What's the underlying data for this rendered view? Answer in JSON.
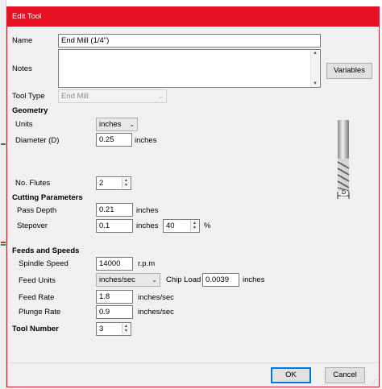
{
  "window": {
    "title": "Edit Tool"
  },
  "fields": {
    "name_label": "Name",
    "name_value": "End Mill (1/4\")",
    "notes_label": "Notes",
    "notes_value": "",
    "variables_button": "Variables",
    "tool_type_label": "Tool Type",
    "tool_type_value": "End Mill"
  },
  "geometry": {
    "heading": "Geometry",
    "units_label": "Units",
    "units_value": "inches",
    "diameter_label": "Diameter (D)",
    "diameter_value": "0.25",
    "diameter_unit": "inches",
    "flutes_label": "No. Flutes",
    "flutes_value": "2",
    "diagram_label": "D"
  },
  "cutting": {
    "heading": "Cutting Parameters",
    "pass_depth_label": "Pass Depth",
    "pass_depth_value": "0.21",
    "pass_depth_unit": "inches",
    "stepover_label": "Stepover",
    "stepover_value": "0.1",
    "stepover_unit": "inches",
    "stepover_percent": "40",
    "percent_sign": "%"
  },
  "feeds": {
    "heading": "Feeds and Speeds",
    "spindle_label": "Spindle Speed",
    "spindle_value": "14000",
    "spindle_unit": "r.p.m",
    "feed_units_label": "Feed Units",
    "feed_units_value": "inches/sec",
    "chip_load_label": "Chip Load",
    "chip_load_value": "0.0039",
    "chip_load_unit": "inches",
    "feed_rate_label": "Feed Rate",
    "feed_rate_value": "1.8",
    "feed_rate_unit": "inches/sec",
    "plunge_rate_label": "Plunge Rate",
    "plunge_rate_value": "0.9",
    "plunge_rate_unit": "inches/sec"
  },
  "tool_number": {
    "heading": "Tool Number",
    "value": "3"
  },
  "buttons": {
    "ok": "OK",
    "cancel": "Cancel"
  },
  "colors": {
    "titlebar": "#e81123",
    "ok_border": "#0078d7"
  },
  "icons": {
    "spin_up": "▲",
    "spin_down": "▼",
    "dropdown": "chevron-down",
    "grip": "resize-grip"
  }
}
